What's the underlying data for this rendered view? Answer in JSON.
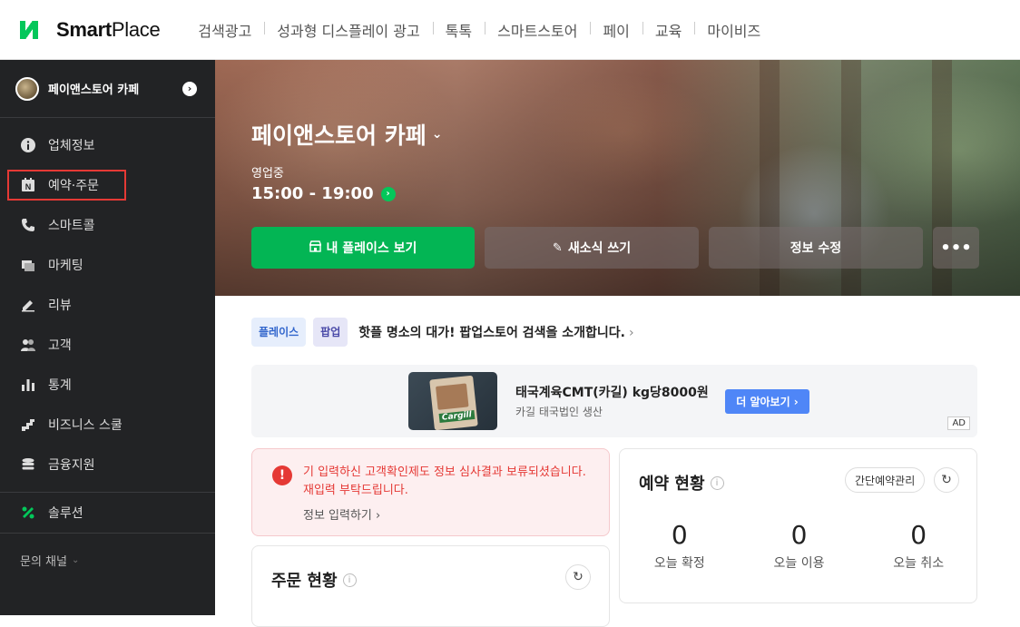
{
  "header": {
    "logo_text_bold": "Smart",
    "logo_text_light": "Place",
    "nav": [
      "검색광고",
      "성과형 디스플레이 광고",
      "톡톡",
      "스마트스토어",
      "페이",
      "교육",
      "마이비즈"
    ]
  },
  "sidebar": {
    "store_name": "페이앤스토어 카페",
    "items": [
      {
        "label": "업체정보",
        "icon": "info-icon"
      },
      {
        "label": "예약·주문",
        "icon": "calendar-n-icon"
      },
      {
        "label": "스마트콜",
        "icon": "phone-icon"
      },
      {
        "label": "마케팅",
        "icon": "marketing-icon"
      },
      {
        "label": "리뷰",
        "icon": "pencil-icon"
      },
      {
        "label": "고객",
        "icon": "people-icon"
      },
      {
        "label": "통계",
        "icon": "chart-icon"
      },
      {
        "label": "비즈니스 스쿨",
        "icon": "stairs-icon"
      },
      {
        "label": "금융지원",
        "icon": "coins-icon"
      }
    ],
    "solution_label": "솔루션",
    "inquiry_label": "문의 채널"
  },
  "hero": {
    "title": "페이앤스토어 카페",
    "status": "영업중",
    "hours": "15:00 - 19:00",
    "btn_place": "내 플레이스 보기",
    "btn_news": "새소식 쓰기",
    "btn_edit": "정보 수정",
    "btn_more": "•••"
  },
  "notice": {
    "tag1": "플레이스",
    "tag2": "팝업",
    "text": "핫플 명소의 대가! 팝업스토어 검색을 소개합니다."
  },
  "ad": {
    "title": "태국계육CMT(카길) kg당8000원",
    "subtitle": "카길 태국법인 생산",
    "button": "더 알아보기 ›",
    "badge": "AD",
    "brand": "Cargill"
  },
  "warning": {
    "text": "기 입력하신 고객확인제도 정보 심사결과 보류되셨습니다. 재입력 부탁드립니다.",
    "link": "정보 입력하기 ›"
  },
  "orders": {
    "title": "주문 현황"
  },
  "reservations": {
    "title": "예약 현황",
    "manage_button": "간단예약관리",
    "stats": [
      {
        "value": "0",
        "label": "오늘 확정"
      },
      {
        "value": "0",
        "label": "오늘 이용"
      },
      {
        "value": "0",
        "label": "오늘 취소"
      }
    ]
  },
  "colors": {
    "brand_green": "#03c75a",
    "sidebar_bg": "#222325",
    "warning_red": "#e53935",
    "ad_button": "#4f86f7"
  }
}
